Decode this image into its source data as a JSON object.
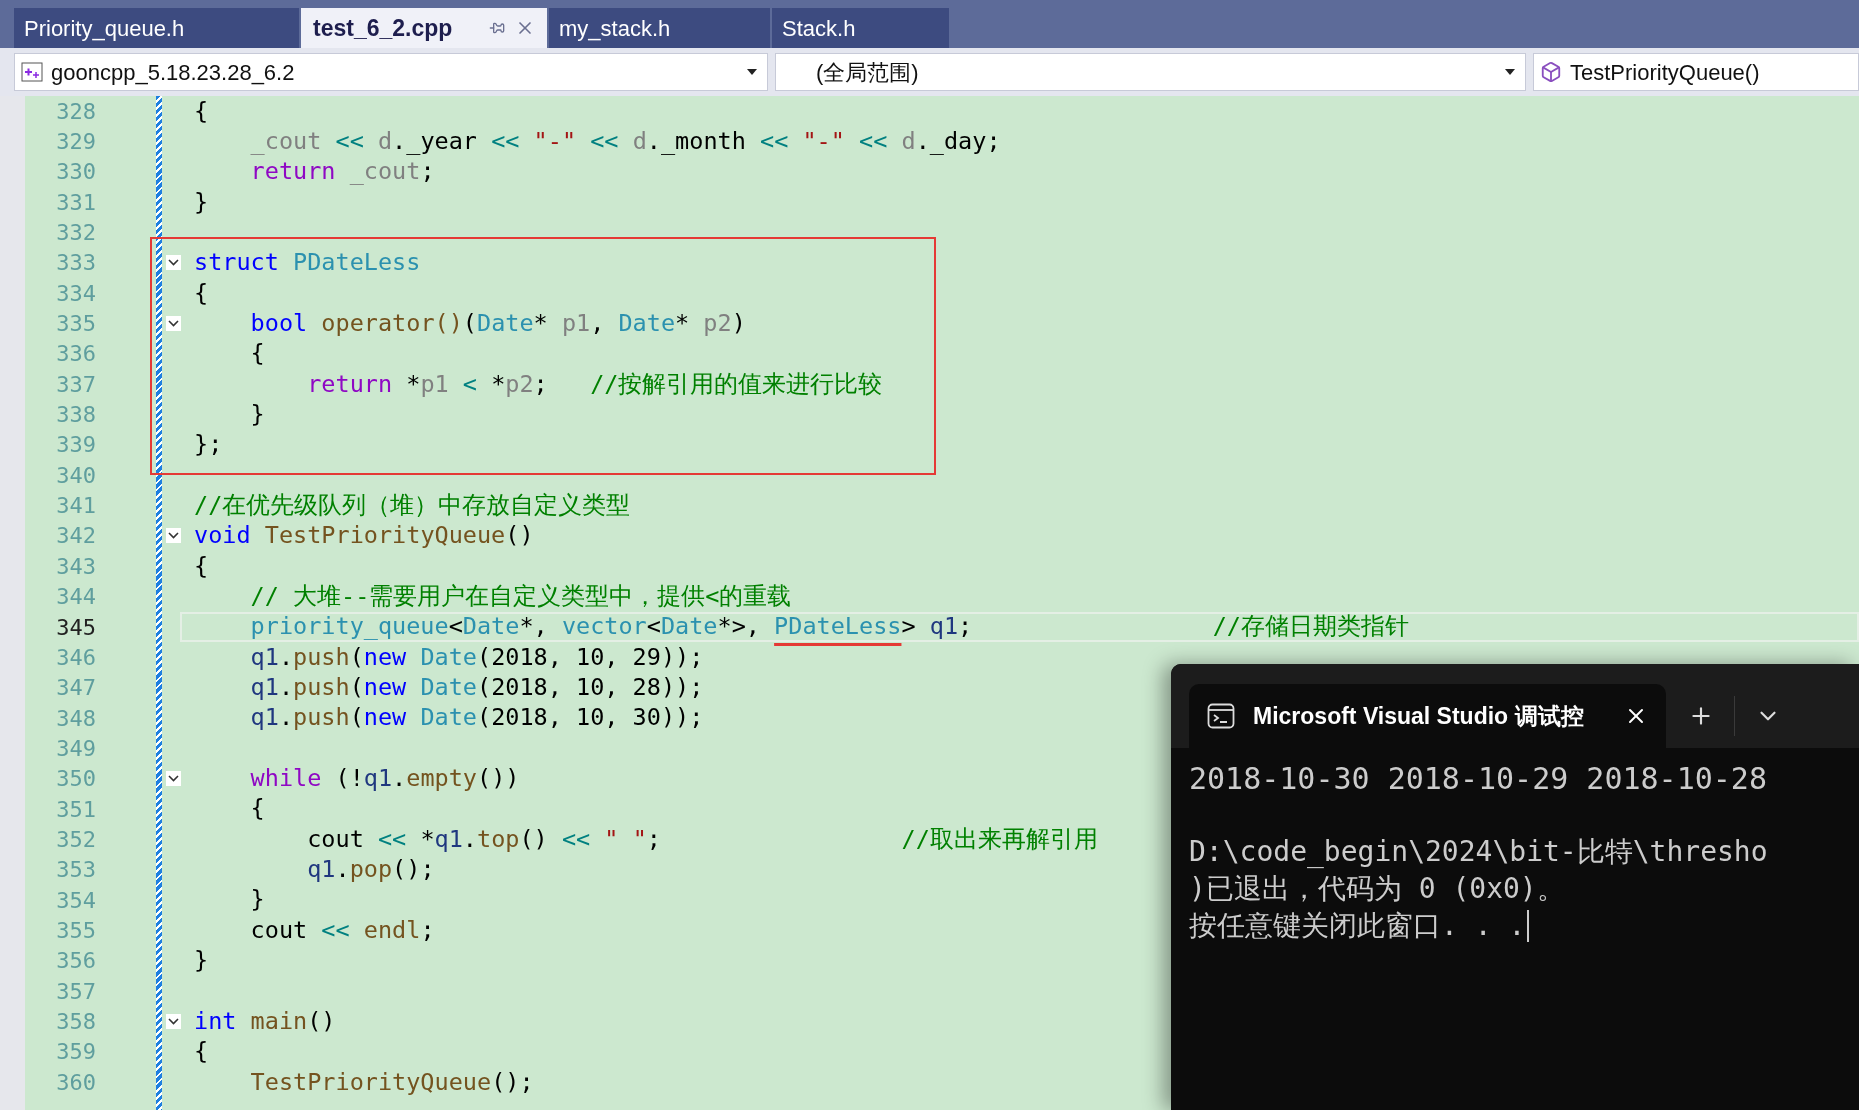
{
  "tabs": [
    {
      "label": "Priority_queue.h",
      "selected": false
    },
    {
      "label": "test_6_2.cpp",
      "selected": true
    },
    {
      "label": "my_stack.h",
      "selected": false
    },
    {
      "label": "Stack.h",
      "selected": false
    }
  ],
  "nav_bar": [
    {
      "kind": "project",
      "text": "gooncpp_5.18.23.28_6.2"
    },
    {
      "kind": "scope",
      "text": "(全局范围)"
    },
    {
      "kind": "member",
      "text": "TestPriorityQueue()"
    }
  ],
  "lines": [
    {
      "kind": "line",
      "number": "328",
      "fold": false,
      "current": false,
      "tokens": [
        {
          "kind": "plain",
          "text": "{"
        }
      ]
    },
    {
      "kind": "line",
      "number": "329",
      "fold": false,
      "current": false,
      "tokens": [
        {
          "kind": "param",
          "text": "    _cout "
        },
        {
          "kind": "op",
          "text": "<< "
        },
        {
          "kind": "param",
          "text": "d"
        },
        {
          "kind": "plain",
          "text": "._year "
        },
        {
          "kind": "op",
          "text": "<< "
        },
        {
          "kind": "str",
          "text": "\"-\" "
        },
        {
          "kind": "op",
          "text": "<< "
        },
        {
          "kind": "param",
          "text": "d"
        },
        {
          "kind": "plain",
          "text": "._month "
        },
        {
          "kind": "op",
          "text": "<< "
        },
        {
          "kind": "str",
          "text": "\"-\" "
        },
        {
          "kind": "op",
          "text": "<< "
        },
        {
          "kind": "param",
          "text": "d"
        },
        {
          "kind": "plain",
          "text": "._day;"
        }
      ]
    },
    {
      "kind": "line",
      "number": "330",
      "fold": false,
      "current": false,
      "tokens": [
        {
          "kind": "ctrl",
          "text": "    return "
        },
        {
          "kind": "param",
          "text": "_cout"
        },
        {
          "kind": "plain",
          "text": ";"
        }
      ]
    },
    {
      "kind": "line",
      "number": "331",
      "fold": false,
      "current": false,
      "tokens": [
        {
          "kind": "plain",
          "text": "}"
        }
      ]
    },
    {
      "kind": "line",
      "number": "332",
      "fold": false,
      "current": false
    },
    {
      "kind": "frame",
      "lines": [
        {
          "kind": "line",
          "number": "333",
          "fold": true,
          "current": false,
          "tokens": [
            {
              "kind": "kw",
              "text": "struct "
            },
            {
              "kind": "type",
              "text": "PDateLess"
            }
          ]
        },
        {
          "kind": "line",
          "number": "334",
          "fold": false,
          "current": false,
          "tokens": [
            {
              "kind": "plain",
              "text": "{"
            }
          ]
        },
        {
          "kind": "line",
          "number": "335",
          "fold": true,
          "current": false,
          "tokens": [
            {
              "kind": "kw",
              "text": "    bool "
            },
            {
              "kind": "fn",
              "text": "operator()"
            },
            {
              "kind": "plain",
              "text": "("
            },
            {
              "kind": "type",
              "text": "Date"
            },
            {
              "kind": "plain",
              "text": "* "
            },
            {
              "kind": "param",
              "text": "p1"
            },
            {
              "kind": "plain",
              "text": ", "
            },
            {
              "kind": "type",
              "text": "Date"
            },
            {
              "kind": "plain",
              "text": "* "
            },
            {
              "kind": "param",
              "text": "p2"
            },
            {
              "kind": "plain",
              "text": ")"
            }
          ]
        },
        {
          "kind": "line",
          "number": "336",
          "fold": false,
          "current": false,
          "tokens": [
            {
              "kind": "plain",
              "text": "    {"
            }
          ]
        },
        {
          "kind": "line",
          "number": "337",
          "fold": false,
          "current": false,
          "tokens": [
            {
              "kind": "ctrl",
              "text": "        return "
            },
            {
              "kind": "plain",
              "text": "*"
            },
            {
              "kind": "param",
              "text": "p1"
            },
            {
              "kind": "op",
              "text": " < "
            },
            {
              "kind": "plain",
              "text": "*"
            },
            {
              "kind": "param",
              "text": "p2"
            },
            {
              "kind": "plain",
              "text": ";   "
            },
            {
              "kind": "cm",
              "text": "//按解引用的值来进行比较"
            }
          ]
        },
        {
          "kind": "line",
          "number": "338",
          "fold": false,
          "current": false,
          "tokens": [
            {
              "kind": "plain",
              "text": "    }"
            }
          ]
        },
        {
          "kind": "line",
          "number": "339",
          "fold": false,
          "current": false,
          "tokens": [
            {
              "kind": "plain",
              "text": "};"
            }
          ]
        }
      ]
    },
    {
      "kind": "line",
      "number": "340",
      "fold": false,
      "current": false
    },
    {
      "kind": "line",
      "number": "341",
      "fold": false,
      "current": false,
      "tokens": [
        {
          "kind": "cm",
          "text": "//在优先级队列（堆）中存放自定义类型"
        }
      ]
    },
    {
      "kind": "line",
      "number": "342",
      "fold": true,
      "current": false,
      "tokens": [
        {
          "kind": "kw",
          "text": "void "
        },
        {
          "kind": "fn",
          "text": "TestPriorityQueue"
        },
        {
          "kind": "plain",
          "text": "()"
        }
      ]
    },
    {
      "kind": "line",
      "number": "343",
      "fold": false,
      "current": false,
      "tokens": [
        {
          "kind": "plain",
          "text": "{"
        }
      ]
    },
    {
      "kind": "line",
      "number": "344",
      "fold": false,
      "current": false,
      "tokens": [
        {
          "kind": "cm",
          "text": "    // 大堆--需要用户在自定义类型中，提供<的重载"
        }
      ]
    },
    {
      "kind": "line",
      "number": "345",
      "fold": false,
      "current": true,
      "tokens": [
        {
          "kind": "type",
          "text": "    priority_queue"
        },
        {
          "kind": "plain",
          "text": "<"
        },
        {
          "kind": "type",
          "text": "Date"
        },
        {
          "kind": "plain",
          "text": "*, "
        },
        {
          "kind": "type",
          "text": "vector"
        },
        {
          "kind": "plain",
          "text": "<"
        },
        {
          "kind": "type",
          "text": "Date"
        },
        {
          "kind": "plain",
          "text": "*>, "
        },
        {
          "kind": "marked_type",
          "text": "PDateLess"
        },
        {
          "kind": "plain",
          "text": "> "
        },
        {
          "kind": "local",
          "text": "q1"
        },
        {
          "kind": "plain",
          "text": ";"
        },
        {
          "kind": "cm",
          "text": "                 //存储日期类指针"
        }
      ]
    },
    {
      "kind": "line",
      "number": "346",
      "fold": false,
      "current": false,
      "tokens": [
        {
          "kind": "local",
          "text": "    q1"
        },
        {
          "kind": "plain",
          "text": "."
        },
        {
          "kind": "fn",
          "text": "push"
        },
        {
          "kind": "plain",
          "text": "("
        },
        {
          "kind": "kw",
          "text": "new "
        },
        {
          "kind": "type",
          "text": "Date"
        },
        {
          "kind": "plain",
          "text": "(2018, 10, 29));"
        }
      ]
    },
    {
      "kind": "line",
      "number": "347",
      "fold": false,
      "current": false,
      "tokens": [
        {
          "kind": "local",
          "text": "    q1"
        },
        {
          "kind": "plain",
          "text": "."
        },
        {
          "kind": "fn",
          "text": "push"
        },
        {
          "kind": "plain",
          "text": "("
        },
        {
          "kind": "kw",
          "text": "new "
        },
        {
          "kind": "type",
          "text": "Date"
        },
        {
          "kind": "plain",
          "text": "(2018, 10, 28));"
        }
      ]
    },
    {
      "kind": "line",
      "number": "348",
      "fold": false,
      "current": false,
      "tokens": [
        {
          "kind": "local",
          "text": "    q1"
        },
        {
          "kind": "plain",
          "text": "."
        },
        {
          "kind": "fn",
          "text": "push"
        },
        {
          "kind": "plain",
          "text": "("
        },
        {
          "kind": "kw",
          "text": "new "
        },
        {
          "kind": "type",
          "text": "Date"
        },
        {
          "kind": "plain",
          "text": "(2018, 10, 30));"
        }
      ]
    },
    {
      "kind": "line",
      "number": "349",
      "fold": false,
      "current": false
    },
    {
      "kind": "line",
      "number": "350",
      "fold": true,
      "current": false,
      "tokens": [
        {
          "kind": "ctrl",
          "text": "    while "
        },
        {
          "kind": "plain",
          "text": "(!"
        },
        {
          "kind": "local",
          "text": "q1"
        },
        {
          "kind": "plain",
          "text": "."
        },
        {
          "kind": "fn",
          "text": "empty"
        },
        {
          "kind": "plain",
          "text": "())"
        }
      ]
    },
    {
      "kind": "line",
      "number": "351",
      "fold": false,
      "current": false,
      "tokens": [
        {
          "kind": "plain",
          "text": "    {"
        }
      ]
    },
    {
      "kind": "line",
      "number": "352",
      "fold": false,
      "current": false,
      "tokens": [
        {
          "kind": "plain",
          "text": "        cout "
        },
        {
          "kind": "op",
          "text": "<< "
        },
        {
          "kind": "plain",
          "text": "*"
        },
        {
          "kind": "local",
          "text": "q1"
        },
        {
          "kind": "plain",
          "text": "."
        },
        {
          "kind": "fn",
          "text": "top"
        },
        {
          "kind": "plain",
          "text": "() "
        },
        {
          "kind": "op",
          "text": "<< "
        },
        {
          "kind": "str",
          "text": "\" \""
        },
        {
          "kind": "plain",
          "text": ";"
        },
        {
          "kind": "cm",
          "text": "                 //取出来再解引用"
        }
      ]
    },
    {
      "kind": "line",
      "number": "353",
      "fold": false,
      "current": false,
      "tokens": [
        {
          "kind": "local",
          "text": "        q1"
        },
        {
          "kind": "plain",
          "text": "."
        },
        {
          "kind": "fn",
          "text": "pop"
        },
        {
          "kind": "plain",
          "text": "();"
        }
      ]
    },
    {
      "kind": "line",
      "number": "354",
      "fold": false,
      "current": false,
      "tokens": [
        {
          "kind": "plain",
          "text": "    }"
        }
      ]
    },
    {
      "kind": "line",
      "number": "355",
      "fold": false,
      "current": false,
      "tokens": [
        {
          "kind": "plain",
          "text": "    cout "
        },
        {
          "kind": "op",
          "text": "<< "
        },
        {
          "kind": "fn",
          "text": "endl"
        },
        {
          "kind": "plain",
          "text": ";"
        }
      ]
    },
    {
      "kind": "line",
      "number": "356",
      "fold": false,
      "current": false,
      "tokens": [
        {
          "kind": "plain",
          "text": "}"
        }
      ]
    },
    {
      "kind": "line",
      "number": "357",
      "fold": false,
      "current": false
    },
    {
      "kind": "line",
      "number": "358",
      "fold": true,
      "current": false,
      "tokens": [
        {
          "kind": "kw",
          "text": "int "
        },
        {
          "kind": "fn",
          "text": "main"
        },
        {
          "kind": "plain",
          "text": "()"
        }
      ]
    },
    {
      "kind": "line",
      "number": "359",
      "fold": false,
      "current": false,
      "tokens": [
        {
          "kind": "plain",
          "text": "{"
        }
      ]
    },
    {
      "kind": "line",
      "number": "360",
      "fold": false,
      "current": false,
      "tokens": [
        {
          "kind": "fn",
          "text": "    TestPriorityQueue"
        },
        {
          "kind": "plain",
          "text": "();"
        }
      ]
    }
  ],
  "terminal": {
    "title": "Microsoft Visual Studio 调试控",
    "output": "2018-10-30 2018-10-29 2018-10-28",
    "messages": [
      "D:\\code_begin\\2024\\bit-比特\\thresho",
      ")已退出，代码为 0 (0x0)。",
      "按任意键关闭此窗口. . ."
    ],
    "cursor": true
  }
}
